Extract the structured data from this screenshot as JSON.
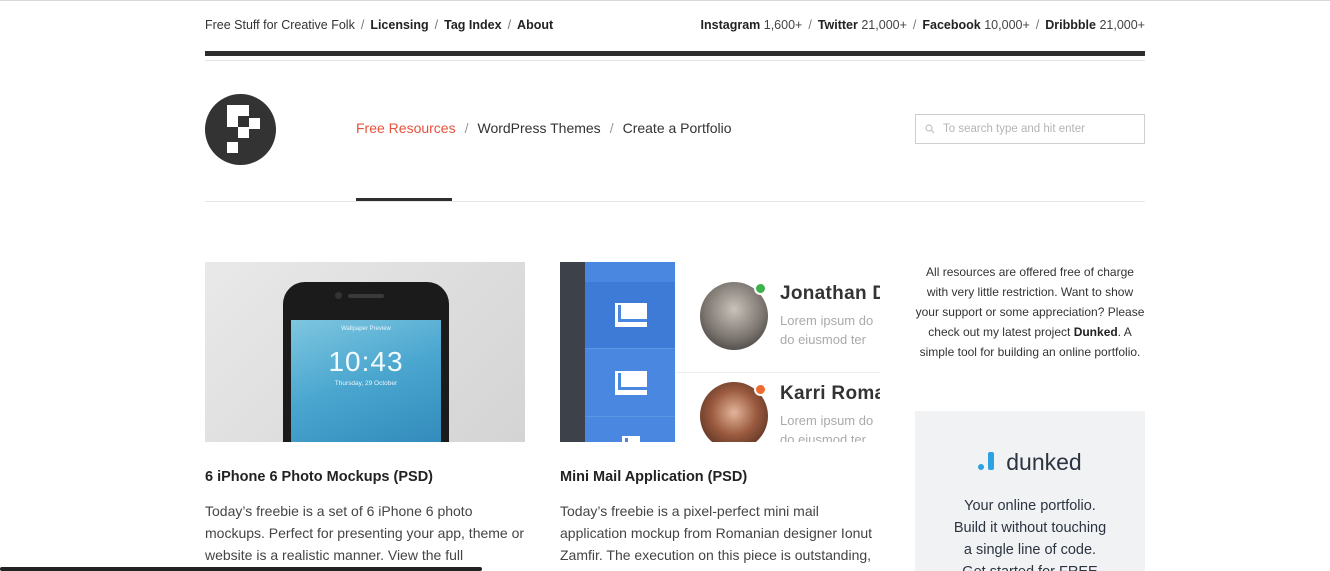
{
  "topbar": {
    "left": [
      {
        "label": "Free Stuff for Creative Folk",
        "strong": false
      },
      {
        "label": "Licensing",
        "strong": true
      },
      {
        "label": "Tag Index",
        "strong": true
      },
      {
        "label": "About",
        "strong": true
      }
    ],
    "social": [
      {
        "name": "Instagram",
        "count": "1,600+"
      },
      {
        "name": "Twitter",
        "count": "21,000+"
      },
      {
        "name": "Facebook",
        "count": "10,000+"
      },
      {
        "name": "Dribbble",
        "count": "21,000+"
      }
    ],
    "separator": "/"
  },
  "nav": {
    "items": [
      "Free Resources",
      "WordPress Themes",
      "Create a Portfolio"
    ],
    "active_index": 0,
    "separator": "/"
  },
  "search": {
    "placeholder": "To search type and hit enter",
    "value": ""
  },
  "posts": [
    {
      "title": "6 iPhone 6 Photo Mockups (PSD)",
      "excerpt": "Today’s freebie is a set of 6 iPhone 6 photo mockups. Perfect for presenting your app, theme or website is a realistic manner. View the full",
      "thumb": {
        "wallpaper_label": "Wallpaper Preview",
        "time": "10:43",
        "date": "Thursday, 29 October"
      }
    },
    {
      "title": "Mini Mail Application (PSD)",
      "excerpt": "Today’s freebie is a pixel-perfect mini mail application mockup from Romanian designer Ionut Zamfir. The execution on this piece is outstanding,",
      "thumb": {
        "contacts": [
          {
            "name": "Jonathan D",
            "preview": [
              "Lorem ipsum do",
              "do eiusmod ter"
            ],
            "status_color": "#3cb34a"
          },
          {
            "name": "Karri Roman",
            "preview": [
              "Lorem ipsum do",
              "do eiusmod ter"
            ],
            "status_color": "#ef6a2f"
          }
        ]
      }
    }
  ],
  "sidebar": {
    "text_before": "All resources are offered free of charge with very little restriction. Want to show your support or some appreciation? Please check out my latest project ",
    "project": "Dunked",
    "text_after": ". A simple tool for building an online portfolio.",
    "ad": {
      "brand": "dunked",
      "lines": [
        "Your online portfolio.",
        "Build it without touching",
        "a single line of code.",
        "Get started for FREE"
      ]
    }
  },
  "colors": {
    "accent": "#e5533d",
    "dark": "#2e2e2e",
    "mail_blue": "#4a87e0",
    "dunked_blue": "#2aa3e0"
  }
}
